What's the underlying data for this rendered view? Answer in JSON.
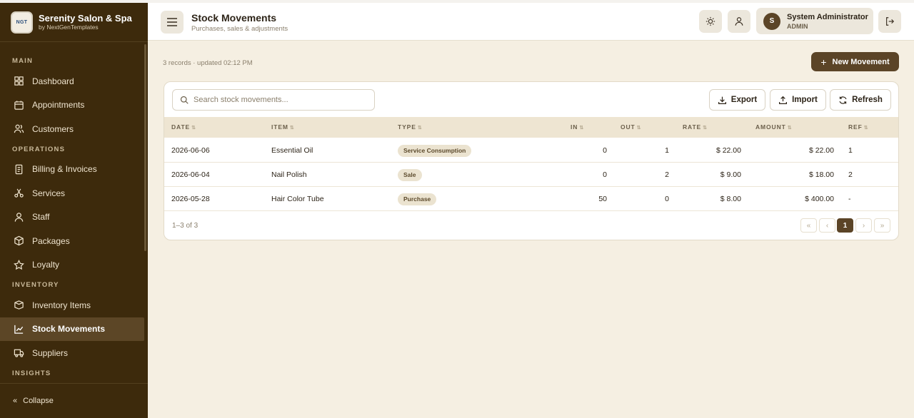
{
  "brand": {
    "logo_text": "NGT",
    "name": "Serenity Salon & Spa",
    "sub": "by NextGenTemplates"
  },
  "sidebar": {
    "sections": [
      {
        "label": "MAIN",
        "items": [
          {
            "label": "Dashboard",
            "icon": "grid-icon"
          },
          {
            "label": "Appointments",
            "icon": "calendar-icon"
          },
          {
            "label": "Customers",
            "icon": "users-icon"
          }
        ]
      },
      {
        "label": "OPERATIONS",
        "items": [
          {
            "label": "Billing & Invoices",
            "icon": "receipt-icon"
          },
          {
            "label": "Services",
            "icon": "scissors-icon"
          },
          {
            "label": "Staff",
            "icon": "user-icon"
          },
          {
            "label": "Packages",
            "icon": "package-icon"
          },
          {
            "label": "Loyalty",
            "icon": "star-icon"
          }
        ]
      },
      {
        "label": "INVENTORY",
        "items": [
          {
            "label": "Inventory Items",
            "icon": "box-icon"
          },
          {
            "label": "Stock Movements",
            "icon": "chart-line-icon",
            "active": true
          },
          {
            "label": "Suppliers",
            "icon": "truck-icon"
          }
        ]
      },
      {
        "label": "INSIGHTS",
        "items": []
      }
    ],
    "collapse_label": "Collapse"
  },
  "header": {
    "title": "Stock Movements",
    "subtitle": "Purchases, sales & adjustments",
    "user": {
      "initial": "S",
      "name": "System Administrator",
      "role": "ADMIN"
    }
  },
  "main": {
    "records_info": "3 records · updated 02:12 PM",
    "new_button": "New Movement"
  },
  "toolbar": {
    "search_placeholder": "Search stock movements...",
    "export_label": "Export",
    "import_label": "Import",
    "refresh_label": "Refresh"
  },
  "table": {
    "columns": [
      "DATE",
      "ITEM",
      "TYPE",
      "IN",
      "OUT",
      "RATE",
      "AMOUNT",
      "REF"
    ],
    "rows": [
      {
        "date": "2026-06-06",
        "item": "Essential Oil",
        "type": "Service Consumption",
        "in": "0",
        "out": "1",
        "rate": "$ 22.00",
        "amount": "$ 22.00",
        "ref": "1"
      },
      {
        "date": "2026-06-04",
        "item": "Nail Polish",
        "type": "Sale",
        "in": "0",
        "out": "2",
        "rate": "$ 9.00",
        "amount": "$ 18.00",
        "ref": "2"
      },
      {
        "date": "2026-05-28",
        "item": "Hair Color Tube",
        "type": "Purchase",
        "in": "50",
        "out": "0",
        "rate": "$ 8.00",
        "amount": "$ 400.00",
        "ref": "-"
      }
    ]
  },
  "pagination": {
    "range": "1–3 of 3",
    "first": "«",
    "prev": "‹",
    "current": "1",
    "next": "›",
    "last": "»"
  }
}
